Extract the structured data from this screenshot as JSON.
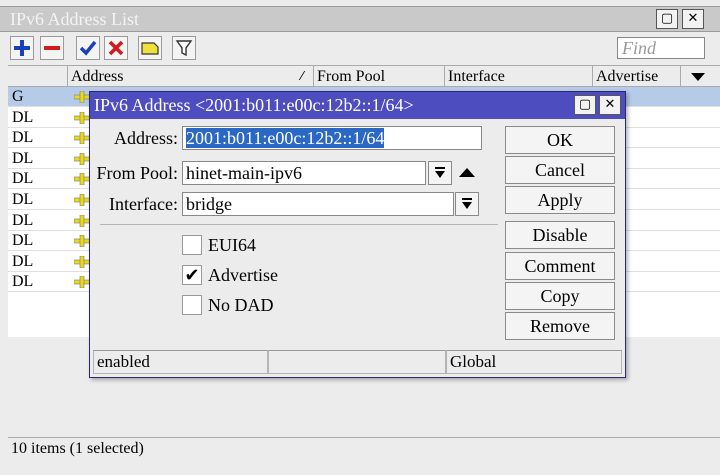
{
  "window": {
    "title": "IPv6 Address List",
    "min_glyph": "▢",
    "close_glyph": "✕"
  },
  "toolbar": {
    "find_placeholder": "Find"
  },
  "table": {
    "columns": [
      "Address",
      "From Pool",
      "Interface",
      "Advertise"
    ],
    "rows": [
      {
        "flag": "G"
      },
      {
        "flag": "DL"
      },
      {
        "flag": "DL"
      },
      {
        "flag": "DL"
      },
      {
        "flag": "DL"
      },
      {
        "flag": "DL"
      },
      {
        "flag": "DL"
      },
      {
        "flag": "DL"
      },
      {
        "flag": "DL"
      },
      {
        "flag": "DL"
      }
    ]
  },
  "status": "10 items (1 selected)",
  "dialog": {
    "title": "IPv6 Address <2001:b011:e00c:12b2::1/64>",
    "fields": {
      "address_label": "Address:",
      "address_value": "2001:b011:e00c:12b2::1/64",
      "from_pool_label": "From Pool:",
      "from_pool_value": "hinet-main-ipv6",
      "interface_label": "Interface:",
      "interface_value": "bridge"
    },
    "checkboxes": {
      "eui64_label": "EUI64",
      "eui64_checked": false,
      "advertise_label": "Advertise",
      "advertise_checked": true,
      "nodad_label": "No DAD",
      "nodad_checked": false
    },
    "buttons": {
      "ok": "OK",
      "cancel": "Cancel",
      "apply": "Apply",
      "disable": "Disable",
      "comment": "Comment",
      "copy": "Copy",
      "remove": "Remove"
    },
    "status": {
      "state": "enabled",
      "middle": "",
      "scope": "Global"
    }
  },
  "colors": {
    "dialog_title_bg": "#4d4dbf",
    "selection_bg": "#2a68c4",
    "selected_row_bg": "#b6cbe8",
    "add_icon": "#1a3fbf",
    "remove_icon": "#d11a1a",
    "check_icon": "#1a3fbf",
    "cross_icon": "#d11a1a"
  }
}
